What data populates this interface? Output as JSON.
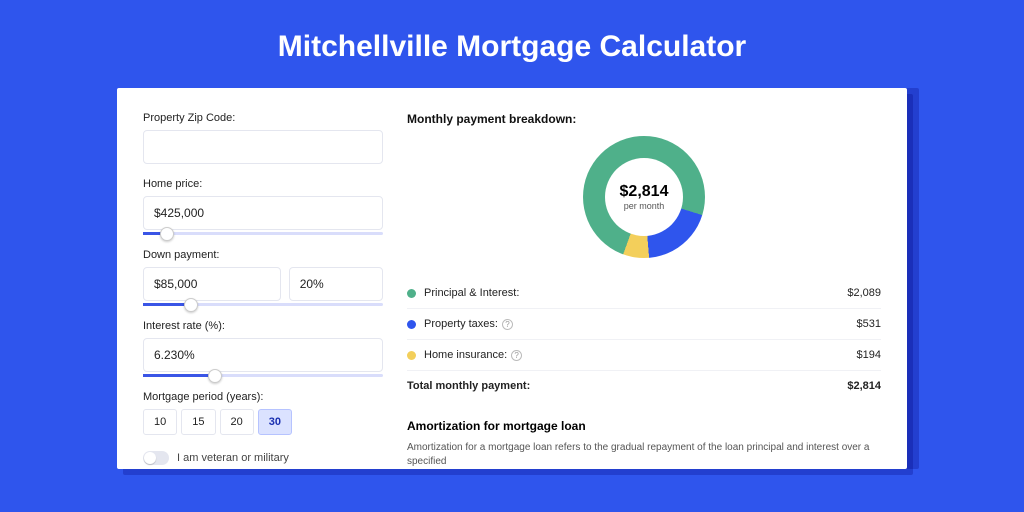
{
  "title": "Mitchellville Mortgage Calculator",
  "form": {
    "zip_label": "Property Zip Code:",
    "zip_value": "",
    "price_label": "Home price:",
    "price_value": "$425,000",
    "down_label": "Down payment:",
    "down_value": "$85,000",
    "down_pct": "20%",
    "rate_label": "Interest rate (%):",
    "rate_value": "6.230%",
    "period_label": "Mortgage period (years):",
    "periods": [
      "10",
      "15",
      "20",
      "30"
    ],
    "period_selected": "30",
    "veteran_label": "I am veteran or military"
  },
  "breakdown": {
    "title": "Monthly payment breakdown:",
    "center_amount": "$2,814",
    "center_sub": "per month",
    "rows": [
      {
        "label": "Principal & Interest:",
        "value": "$2,089",
        "color": "#4fb08a",
        "help": false
      },
      {
        "label": "Property taxes:",
        "value": "$531",
        "color": "#2f55ed",
        "help": true
      },
      {
        "label": "Home insurance:",
        "value": "$194",
        "color": "#f3cf5b",
        "help": true
      }
    ],
    "total_label": "Total monthly payment:",
    "total_value": "$2,814"
  },
  "amort": {
    "title": "Amortization for mortgage loan",
    "text": "Amortization for a mortgage loan refers to the gradual repayment of the loan principal and interest over a specified"
  },
  "chart_data": {
    "type": "pie",
    "title": "Monthly payment breakdown",
    "series": [
      {
        "name": "Principal & Interest",
        "value": 2089,
        "color": "#4fb08a"
      },
      {
        "name": "Property taxes",
        "value": 531,
        "color": "#2f55ed"
      },
      {
        "name": "Home insurance",
        "value": 194,
        "color": "#f3cf5b"
      }
    ],
    "total": 2814
  }
}
